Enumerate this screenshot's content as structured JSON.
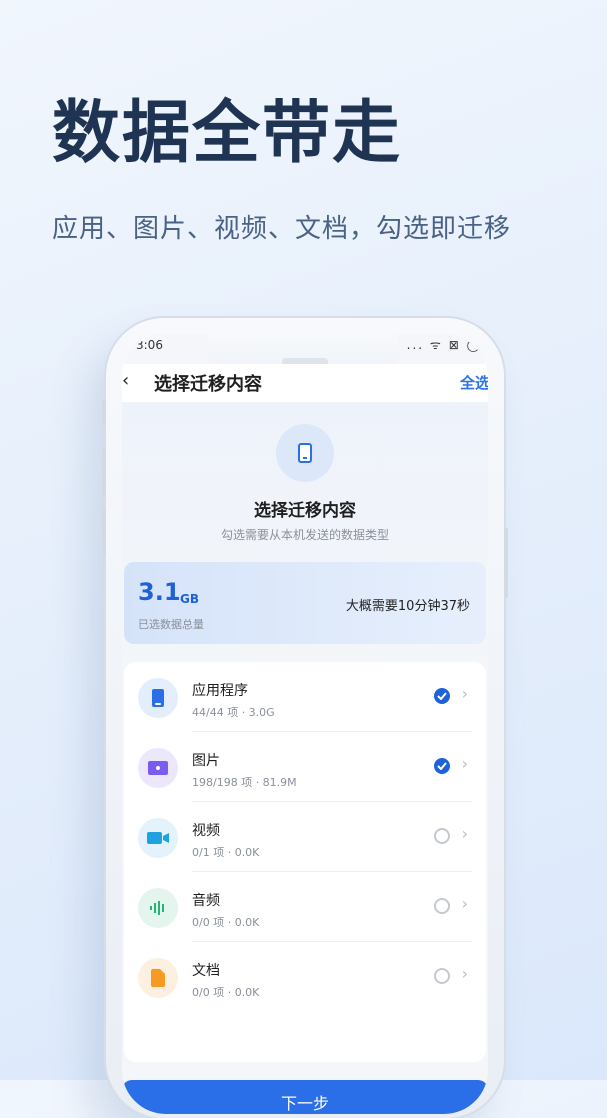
{
  "promo": {
    "headline": "数据全带走",
    "subline": "应用、图片、视频、文档，勾选即迁移"
  },
  "status_bar": {
    "time": "3:06",
    "icons": "... ᯤ ⊠ ◯"
  },
  "nav": {
    "back": "‹",
    "title": "选择迁移内容",
    "action": "全选"
  },
  "hero": {
    "title": "选择迁移内容",
    "subtitle": "勾选需要从本机发送的数据类型"
  },
  "summary": {
    "total": "3.1",
    "unit": "GB",
    "label": "已选数据总量",
    "eta": "大概需要10分钟37秒"
  },
  "items": [
    {
      "title": "应用程序",
      "sub": "44/44 项 · 3.0G",
      "checked": true,
      "icon": "app-icon",
      "color": "#2a6fe8",
      "bg": "#e4edfb"
    },
    {
      "title": "图片",
      "sub": "198/198 项 · 81.9M",
      "checked": true,
      "icon": "image-icon",
      "color": "#7a5cf0",
      "bg": "#ece7fb"
    },
    {
      "title": "视频",
      "sub": "0/1 项 · 0.0K",
      "checked": false,
      "icon": "video-icon",
      "color": "#1fa3e0",
      "bg": "#e3f2fb"
    },
    {
      "title": "音频",
      "sub": "0/0 项 · 0.0K",
      "checked": false,
      "icon": "audio-icon",
      "color": "#22b573",
      "bg": "#e3f5ec"
    },
    {
      "title": "文档",
      "sub": "0/0 项 · 0.0K",
      "checked": false,
      "icon": "document-icon",
      "color": "#f59a23",
      "bg": "#fdf0e0"
    }
  ],
  "chevron": "›",
  "next_button": "下一步"
}
